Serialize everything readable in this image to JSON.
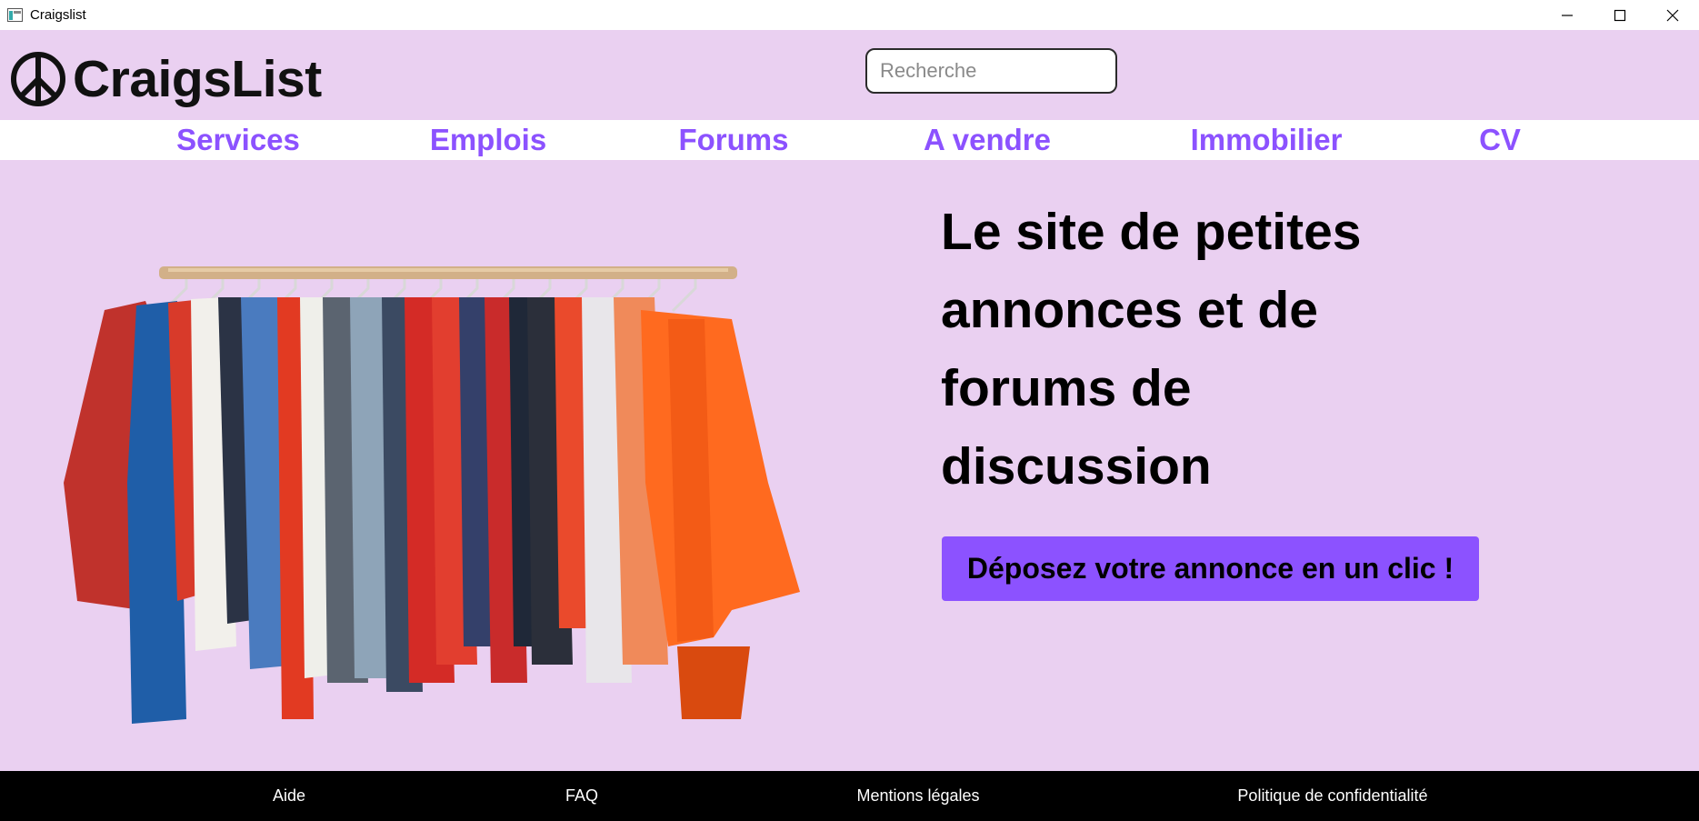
{
  "window": {
    "title": "Craigslist",
    "icons": [
      "app-icon",
      "minimize-icon",
      "maximize-icon",
      "close-icon"
    ]
  },
  "header": {
    "logo_text": "CraigsList",
    "logo_icon": "peace-symbol-icon",
    "search_placeholder": "Recherche"
  },
  "nav": {
    "items": [
      {
        "label": "Services"
      },
      {
        "label": "Emplois"
      },
      {
        "label": "Forums"
      },
      {
        "label": "A vendre"
      },
      {
        "label": "Immobilier"
      },
      {
        "label": "CV"
      }
    ]
  },
  "hero": {
    "headline": "Le site de petites annonces et de forums de discussion",
    "cta_label": "Déposez votre annonce en un clic !",
    "image": "clothing-rack-photo"
  },
  "footer": {
    "links": [
      {
        "label": "Aide"
      },
      {
        "label": "FAQ"
      },
      {
        "label": "Mentions légales"
      },
      {
        "label": "Politique de confidentialité"
      }
    ]
  },
  "colors": {
    "background": "#ead0f1",
    "accent": "#8c52ff",
    "nav_background": "#ffffff",
    "footer_background": "#000000"
  }
}
